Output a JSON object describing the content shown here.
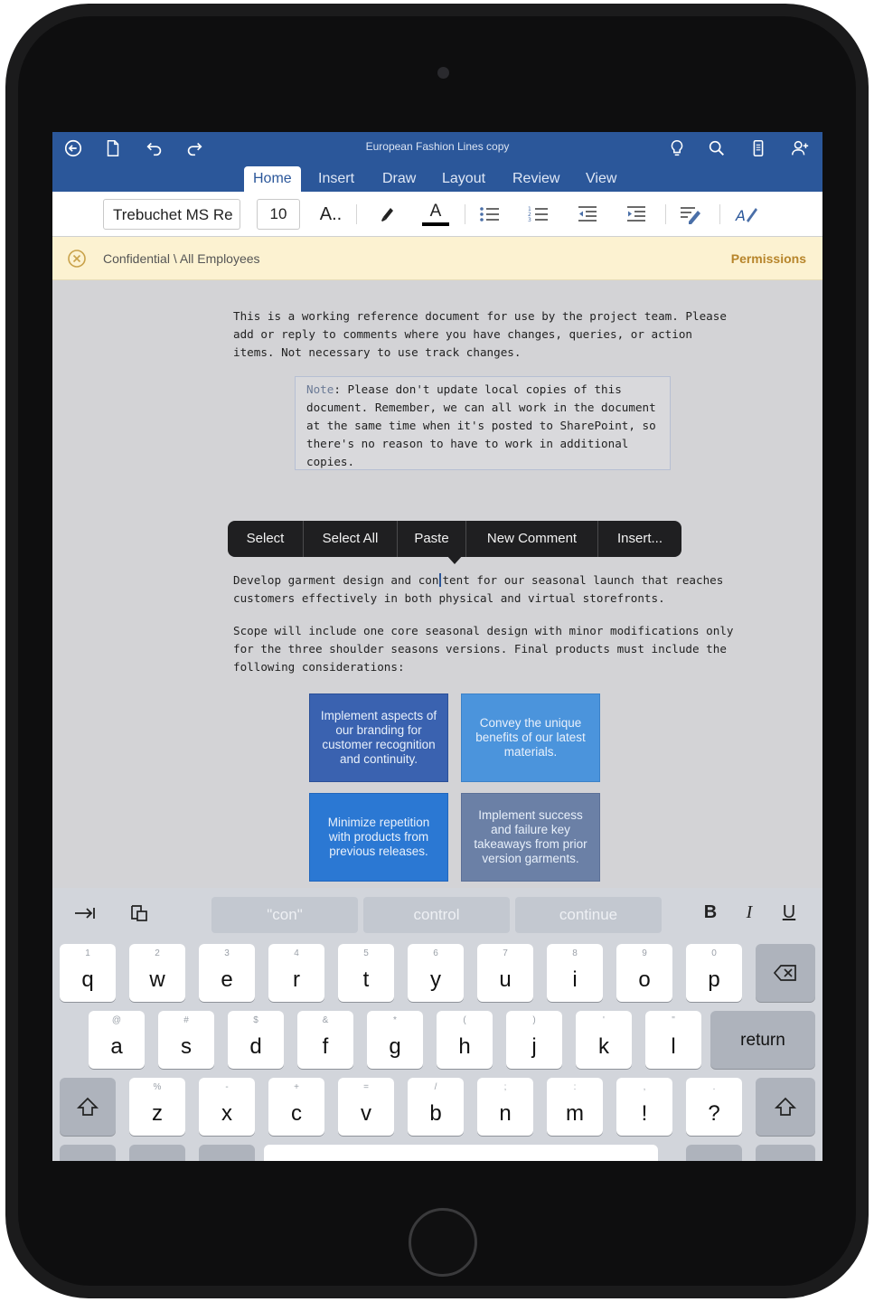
{
  "window": {
    "title": "European Fashion Lines copy"
  },
  "tabs": [
    {
      "label": "Home",
      "active": true
    },
    {
      "label": "Insert",
      "active": false
    },
    {
      "label": "Draw",
      "active": false
    },
    {
      "label": "Layout",
      "active": false
    },
    {
      "label": "Review",
      "active": false
    },
    {
      "label": "View",
      "active": false
    }
  ],
  "ribbon": {
    "font_name": "Trebuchet MS Re",
    "font_size": "10",
    "font_size_icon_label": "A..",
    "font_color_icon_label": "A",
    "font_color": "#000000"
  },
  "infobar": {
    "label": "Confidential \\ All Employees",
    "permissions_link": "Permissions"
  },
  "document": {
    "para1": "This is a working reference document for use by the project team. Please add or reply to comments where you have changes, queries, or action items. Not necessary to use track changes.",
    "note_label": "Note",
    "note_text": ": Please don't update local copies of this document. Remember, we can all work in the document at the same time when it's posted to SharePoint, so there's no reason to have to work in additional copies.",
    "para2_before_cursor": "Develop garment design and con",
    "para2_after_cursor": "tent for our seasonal launch that reaches customers effectively in both physical and virtual storefronts.",
    "para3": "Scope will include one core seasonal design with minor modifications only for the three shoulder seasons versions.  Final products must include the following considerations:",
    "smart_boxes": [
      "Implement aspects of our branding for customer recognition and continuity.",
      "Convey the unique benefits of our latest materials.",
      "Minimize repetition with products from previous releases.",
      "Implement success and failure key takeaways from prior version garments."
    ]
  },
  "context_menu": {
    "items": [
      "Select",
      "Select All",
      "Paste",
      "New Comment",
      "Insert..."
    ]
  },
  "keyboard": {
    "suggestions": [
      "\"con\"",
      "control",
      "continue"
    ],
    "format_buttons": [
      "B",
      "I",
      "U"
    ],
    "row1": [
      {
        "main": "q",
        "sub": "1"
      },
      {
        "main": "w",
        "sub": "2"
      },
      {
        "main": "e",
        "sub": "3"
      },
      {
        "main": "r",
        "sub": "4"
      },
      {
        "main": "t",
        "sub": "5"
      },
      {
        "main": "y",
        "sub": "6"
      },
      {
        "main": "u",
        "sub": "7"
      },
      {
        "main": "i",
        "sub": "8"
      },
      {
        "main": "o",
        "sub": "9"
      },
      {
        "main": "p",
        "sub": "0"
      }
    ],
    "row2": [
      {
        "main": "a",
        "sub": "@"
      },
      {
        "main": "s",
        "sub": "#"
      },
      {
        "main": "d",
        "sub": "$"
      },
      {
        "main": "f",
        "sub": "&"
      },
      {
        "main": "g",
        "sub": "*"
      },
      {
        "main": "h",
        "sub": "("
      },
      {
        "main": "j",
        "sub": ")"
      },
      {
        "main": "k",
        "sub": "'"
      },
      {
        "main": "l",
        "sub": "\""
      }
    ],
    "row3": [
      {
        "main": "z",
        "sub": "%"
      },
      {
        "main": "x",
        "sub": "-"
      },
      {
        "main": "c",
        "sub": "+"
      },
      {
        "main": "v",
        "sub": "="
      },
      {
        "main": "b",
        "sub": "/"
      },
      {
        "main": "n",
        "sub": ";"
      },
      {
        "main": "m",
        "sub": ":"
      },
      {
        "main": "!",
        "sub": ","
      },
      {
        "main": "?",
        "sub": "."
      }
    ],
    "return_label": "return"
  }
}
